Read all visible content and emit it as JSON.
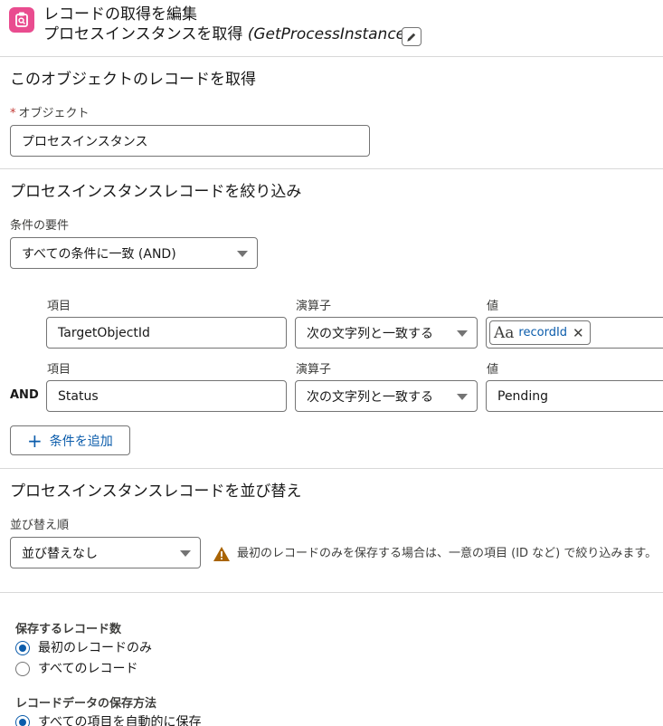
{
  "header": {
    "title": "レコードの取得を編集",
    "subtitle": "プロセスインスタンスを取得",
    "api_name": "(GetProcessInstance)"
  },
  "object_section": {
    "title": "このオブジェクトのレコードを取得",
    "field_label": "オブジェクト",
    "required_mark": "*",
    "value": "プロセスインスタンス"
  },
  "filter_section": {
    "title": "プロセスインスタンスレコードを絞り込み",
    "requirement_label": "条件の要件",
    "requirement_value": "すべての条件に一致 (AND)",
    "conditions": [
      {
        "connector": "",
        "field_label": "項目",
        "field_value": "TargetObjectId",
        "operator_label": "演算子",
        "operator_value": "次の文字列と一致する",
        "value_label": "値",
        "value_icon": "Aa",
        "value": "recordId"
      },
      {
        "connector": "AND",
        "field_label": "項目",
        "field_value": "Status",
        "operator_label": "演算子",
        "operator_value": "次の文字列と一致する",
        "value_label": "値",
        "value": "Pending"
      }
    ],
    "add_condition_label": "条件を追加"
  },
  "sort_section": {
    "title": "プロセスインスタンスレコードを並び替え",
    "order_label": "並び替え順",
    "order_value": "並び替えなし",
    "warning_text": "最初のレコードのみを保存する場合は、一意の項目 (ID など) で絞り込みます。"
  },
  "store_section": {
    "count_label": "保存するレコード数",
    "options": [
      "最初のレコードのみ",
      "すべてのレコード"
    ],
    "selected_index": 0,
    "method_label": "レコードデータの保存方法",
    "method_option": "すべての項目を自動的に保存"
  },
  "colors": {
    "brand_pink": "#e94c8f",
    "link_blue": "#0b5cab",
    "warning_orange": "#a96404",
    "border": "#747474"
  }
}
